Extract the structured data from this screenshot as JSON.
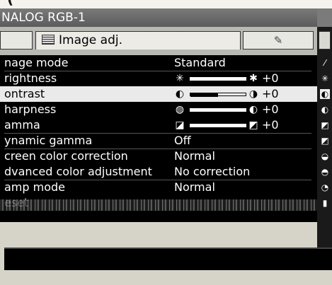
{
  "window": {
    "title": "NALOG RGB-1"
  },
  "tabs": {
    "active_label": "Image adj.",
    "right_tab_icon": "pen-icon"
  },
  "rows": [
    {
      "label": "nage mode",
      "value": "Standard"
    },
    {
      "label": "rightness",
      "value": "+0",
      "level": 0.5,
      "icon": "brightness-icon"
    },
    {
      "label": "ontrast",
      "value": "+0",
      "level": 0.5,
      "icon": "contrast-icon",
      "selected": true
    },
    {
      "label": "harpness",
      "value": "+0",
      "level": 0.5,
      "icon": "sharpness-icon"
    },
    {
      "label": "amma",
      "value": "+0",
      "level": 0.5,
      "icon": "gamma-icon"
    },
    {
      "label": "ynamic gamma",
      "value": "Off"
    },
    {
      "label": "creen color correction",
      "value": "Normal"
    },
    {
      "label": "dvanced color adjustment",
      "value": "No correction"
    },
    {
      "label": "amp mode",
      "value": "Normal"
    },
    {
      "label": "eset",
      "value": ""
    }
  ],
  "colors": {
    "selected_row_bg": "#eaeaea",
    "menu_bg": "#000000",
    "title_bar": "#6a6a6a"
  }
}
